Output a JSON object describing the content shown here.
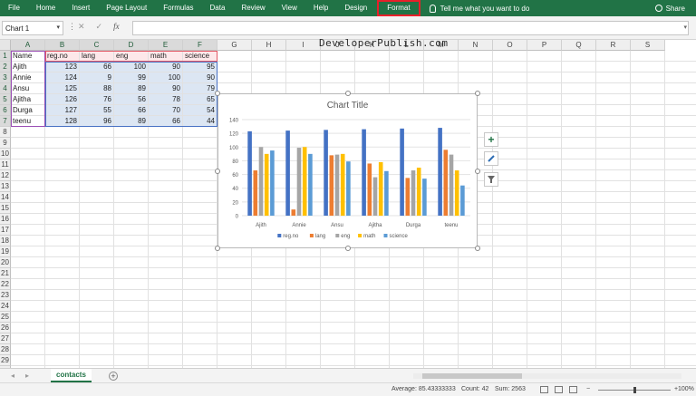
{
  "ribbon": {
    "tabs": [
      "File",
      "Home",
      "Insert",
      "Page Layout",
      "Formulas",
      "Data",
      "Review",
      "View",
      "Help",
      "Design",
      "Format"
    ],
    "tell_me": "Tell me what you want to do",
    "share": "Share",
    "colors": {
      "ribbon_bg": "#217346",
      "highlight_border": "#e8202a"
    }
  },
  "formula_bar": {
    "name_box": "Chart 1",
    "formula": ""
  },
  "columns": [
    "A",
    "B",
    "C",
    "D",
    "E",
    "F",
    "G",
    "H",
    "I",
    "J",
    "K",
    "L",
    "M",
    "N",
    "O",
    "P",
    "Q",
    "R",
    "S"
  ],
  "rows": [
    "1",
    "2",
    "3",
    "4",
    "5",
    "6",
    "7",
    "8",
    "9",
    "10",
    "11",
    "12",
    "13",
    "14",
    "15",
    "16",
    "17",
    "18",
    "19",
    "20",
    "21",
    "22",
    "23",
    "24",
    "25",
    "26",
    "27",
    "28",
    "29",
    "30"
  ],
  "table": {
    "headers": [
      "Name",
      "reg.no",
      "lang",
      "eng",
      "math",
      "science"
    ],
    "rows": [
      [
        "Ajith",
        "123",
        "66",
        "100",
        "90",
        "95"
      ],
      [
        "Annie",
        "124",
        "9",
        "99",
        "100",
        "90"
      ],
      [
        "Ansu",
        "125",
        "88",
        "89",
        "90",
        "79"
      ],
      [
        "Ajitha",
        "126",
        "76",
        "56",
        "78",
        "65"
      ],
      [
        "Durga",
        "127",
        "55",
        "66",
        "70",
        "54"
      ],
      [
        "teenu",
        "128",
        "96",
        "89",
        "66",
        "44"
      ]
    ]
  },
  "watermark": "DeveloperPublish.com",
  "chart_data": {
    "type": "bar",
    "title": "Chart Title",
    "categories": [
      "Ajith",
      "Annie",
      "Ansu",
      "Ajitha",
      "Durga",
      "teenu"
    ],
    "series": [
      {
        "name": "reg.no",
        "color": "#4472c4",
        "values": [
          123,
          124,
          125,
          126,
          127,
          128
        ]
      },
      {
        "name": "lang",
        "color": "#ed7d31",
        "values": [
          66,
          9,
          88,
          76,
          55,
          96
        ]
      },
      {
        "name": "eng",
        "color": "#a5a5a5",
        "values": [
          100,
          99,
          89,
          56,
          66,
          89
        ]
      },
      {
        "name": "math",
        "color": "#ffc000",
        "values": [
          90,
          100,
          90,
          78,
          70,
          66
        ]
      },
      {
        "name": "science",
        "color": "#5b9bd5",
        "values": [
          95,
          90,
          79,
          65,
          54,
          44
        ]
      }
    ],
    "yticks": [
      "0",
      "20",
      "40",
      "60",
      "80",
      "100",
      "120",
      "140"
    ],
    "ylim": [
      0,
      140
    ],
    "grid": true,
    "legend": "bottom"
  },
  "sheet_tabs": {
    "active": "contacts"
  },
  "status": {
    "average": "Average: 85.43333333",
    "count": "Count: 42",
    "sum": "Sum: 2563",
    "zoom": "100%"
  }
}
